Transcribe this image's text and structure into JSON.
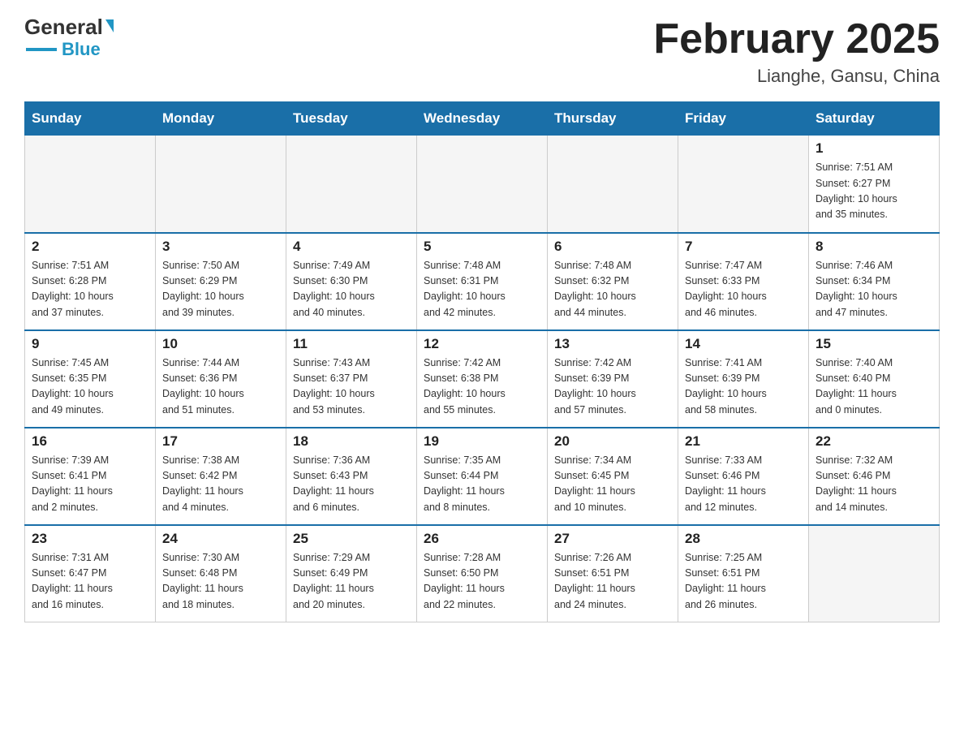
{
  "header": {
    "logo_general": "General",
    "logo_blue": "Blue",
    "month_title": "February 2025",
    "location": "Lianghe, Gansu, China"
  },
  "weekdays": [
    "Sunday",
    "Monday",
    "Tuesday",
    "Wednesday",
    "Thursday",
    "Friday",
    "Saturday"
  ],
  "weeks": [
    [
      {
        "day": "",
        "info": ""
      },
      {
        "day": "",
        "info": ""
      },
      {
        "day": "",
        "info": ""
      },
      {
        "day": "",
        "info": ""
      },
      {
        "day": "",
        "info": ""
      },
      {
        "day": "",
        "info": ""
      },
      {
        "day": "1",
        "info": "Sunrise: 7:51 AM\nSunset: 6:27 PM\nDaylight: 10 hours\nand 35 minutes."
      }
    ],
    [
      {
        "day": "2",
        "info": "Sunrise: 7:51 AM\nSunset: 6:28 PM\nDaylight: 10 hours\nand 37 minutes."
      },
      {
        "day": "3",
        "info": "Sunrise: 7:50 AM\nSunset: 6:29 PM\nDaylight: 10 hours\nand 39 minutes."
      },
      {
        "day": "4",
        "info": "Sunrise: 7:49 AM\nSunset: 6:30 PM\nDaylight: 10 hours\nand 40 minutes."
      },
      {
        "day": "5",
        "info": "Sunrise: 7:48 AM\nSunset: 6:31 PM\nDaylight: 10 hours\nand 42 minutes."
      },
      {
        "day": "6",
        "info": "Sunrise: 7:48 AM\nSunset: 6:32 PM\nDaylight: 10 hours\nand 44 minutes."
      },
      {
        "day": "7",
        "info": "Sunrise: 7:47 AM\nSunset: 6:33 PM\nDaylight: 10 hours\nand 46 minutes."
      },
      {
        "day": "8",
        "info": "Sunrise: 7:46 AM\nSunset: 6:34 PM\nDaylight: 10 hours\nand 47 minutes."
      }
    ],
    [
      {
        "day": "9",
        "info": "Sunrise: 7:45 AM\nSunset: 6:35 PM\nDaylight: 10 hours\nand 49 minutes."
      },
      {
        "day": "10",
        "info": "Sunrise: 7:44 AM\nSunset: 6:36 PM\nDaylight: 10 hours\nand 51 minutes."
      },
      {
        "day": "11",
        "info": "Sunrise: 7:43 AM\nSunset: 6:37 PM\nDaylight: 10 hours\nand 53 minutes."
      },
      {
        "day": "12",
        "info": "Sunrise: 7:42 AM\nSunset: 6:38 PM\nDaylight: 10 hours\nand 55 minutes."
      },
      {
        "day": "13",
        "info": "Sunrise: 7:42 AM\nSunset: 6:39 PM\nDaylight: 10 hours\nand 57 minutes."
      },
      {
        "day": "14",
        "info": "Sunrise: 7:41 AM\nSunset: 6:39 PM\nDaylight: 10 hours\nand 58 minutes."
      },
      {
        "day": "15",
        "info": "Sunrise: 7:40 AM\nSunset: 6:40 PM\nDaylight: 11 hours\nand 0 minutes."
      }
    ],
    [
      {
        "day": "16",
        "info": "Sunrise: 7:39 AM\nSunset: 6:41 PM\nDaylight: 11 hours\nand 2 minutes."
      },
      {
        "day": "17",
        "info": "Sunrise: 7:38 AM\nSunset: 6:42 PM\nDaylight: 11 hours\nand 4 minutes."
      },
      {
        "day": "18",
        "info": "Sunrise: 7:36 AM\nSunset: 6:43 PM\nDaylight: 11 hours\nand 6 minutes."
      },
      {
        "day": "19",
        "info": "Sunrise: 7:35 AM\nSunset: 6:44 PM\nDaylight: 11 hours\nand 8 minutes."
      },
      {
        "day": "20",
        "info": "Sunrise: 7:34 AM\nSunset: 6:45 PM\nDaylight: 11 hours\nand 10 minutes."
      },
      {
        "day": "21",
        "info": "Sunrise: 7:33 AM\nSunset: 6:46 PM\nDaylight: 11 hours\nand 12 minutes."
      },
      {
        "day": "22",
        "info": "Sunrise: 7:32 AM\nSunset: 6:46 PM\nDaylight: 11 hours\nand 14 minutes."
      }
    ],
    [
      {
        "day": "23",
        "info": "Sunrise: 7:31 AM\nSunset: 6:47 PM\nDaylight: 11 hours\nand 16 minutes."
      },
      {
        "day": "24",
        "info": "Sunrise: 7:30 AM\nSunset: 6:48 PM\nDaylight: 11 hours\nand 18 minutes."
      },
      {
        "day": "25",
        "info": "Sunrise: 7:29 AM\nSunset: 6:49 PM\nDaylight: 11 hours\nand 20 minutes."
      },
      {
        "day": "26",
        "info": "Sunrise: 7:28 AM\nSunset: 6:50 PM\nDaylight: 11 hours\nand 22 minutes."
      },
      {
        "day": "27",
        "info": "Sunrise: 7:26 AM\nSunset: 6:51 PM\nDaylight: 11 hours\nand 24 minutes."
      },
      {
        "day": "28",
        "info": "Sunrise: 7:25 AM\nSunset: 6:51 PM\nDaylight: 11 hours\nand 26 minutes."
      },
      {
        "day": "",
        "info": ""
      }
    ]
  ]
}
